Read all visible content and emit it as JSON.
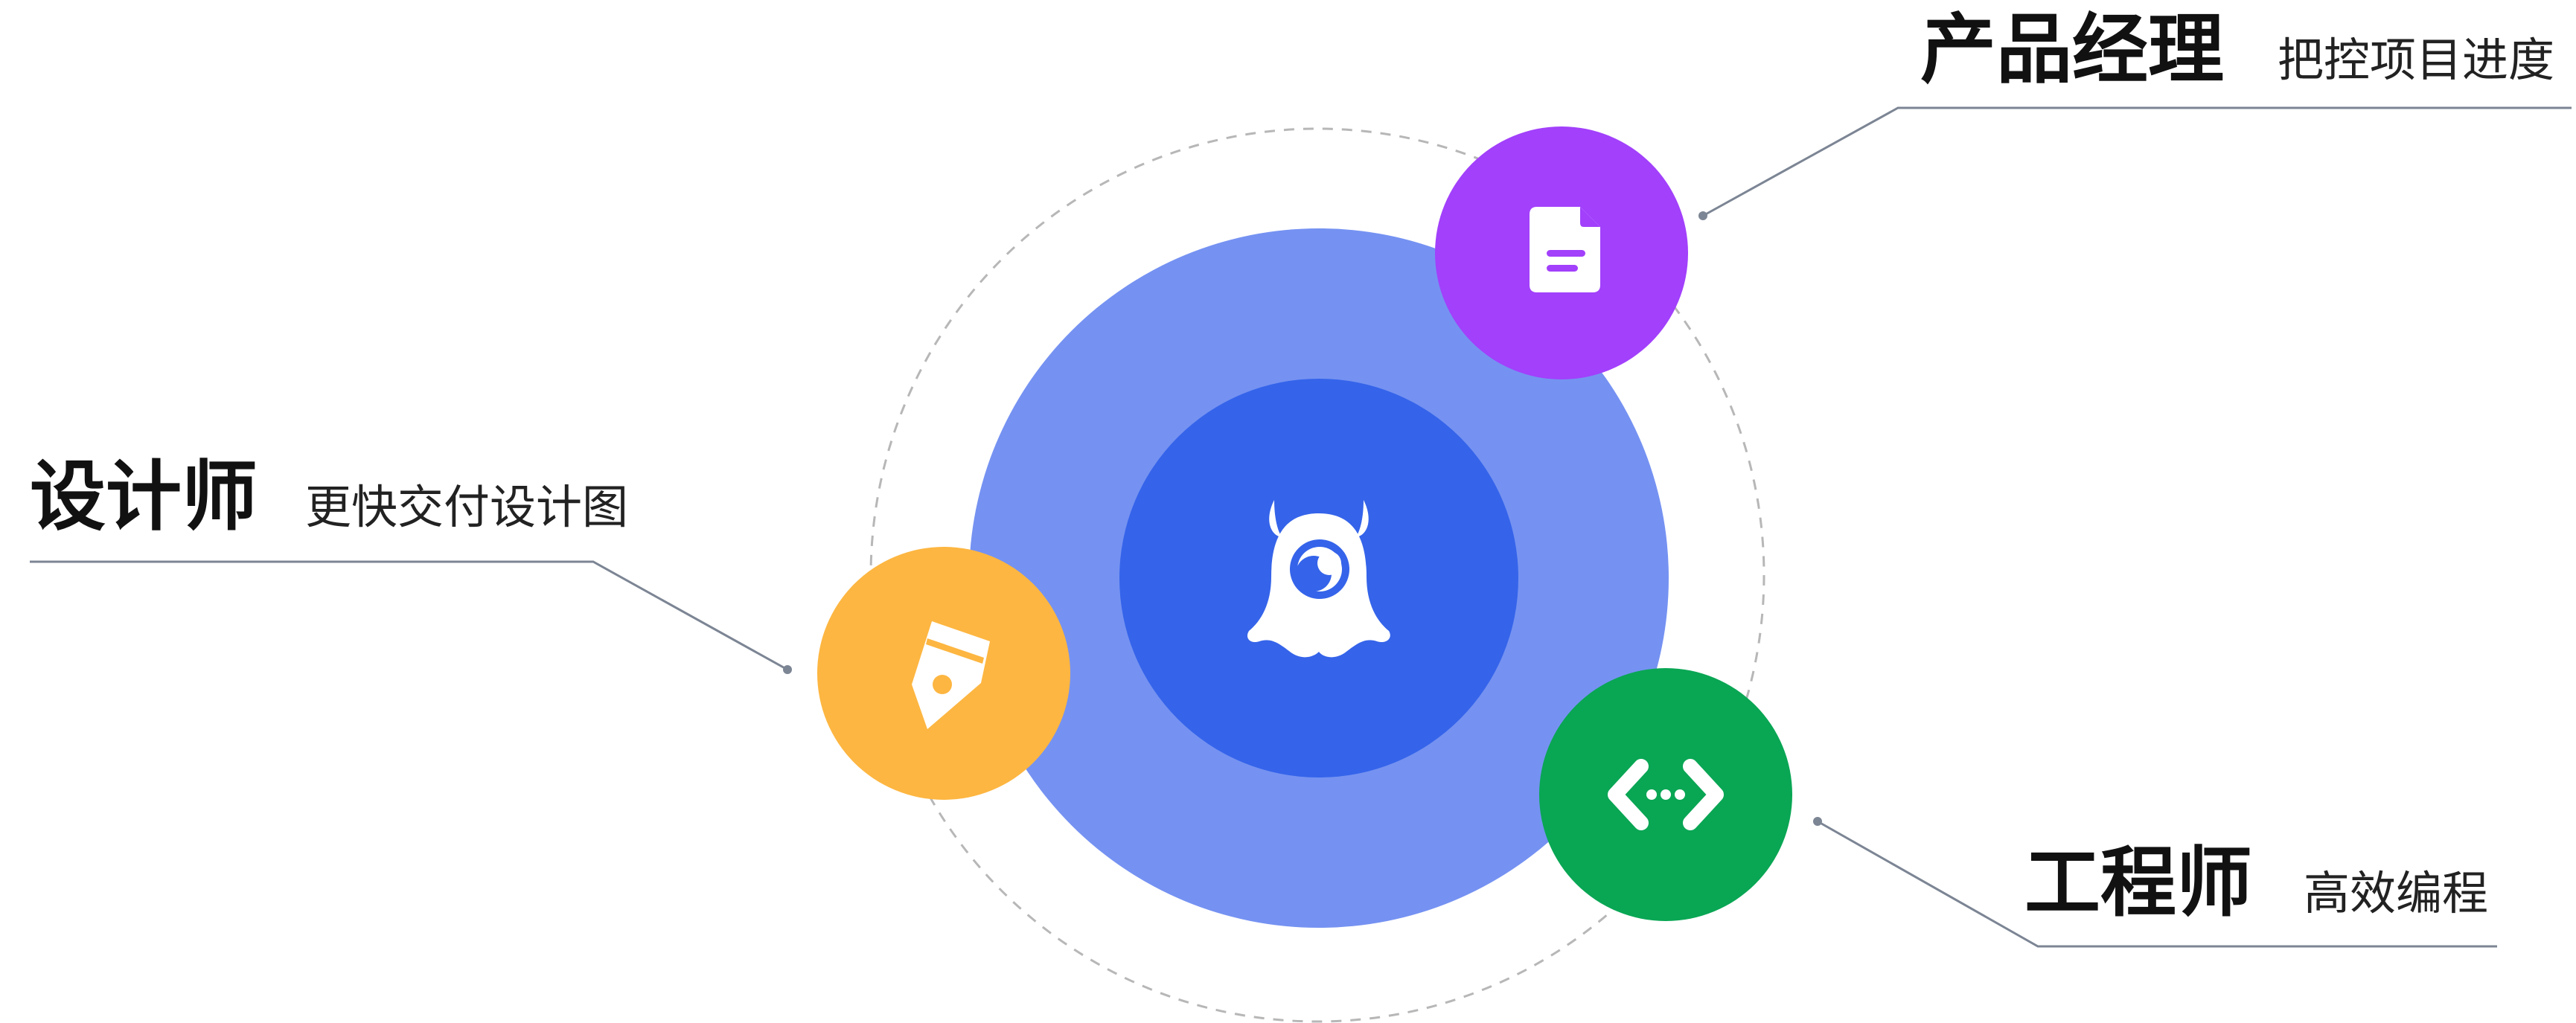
{
  "colors": {
    "outer_ring": "#7592f2",
    "core": "#3564ea",
    "product": "#a240fb",
    "designer": "#fdb641",
    "engineer": "#09a654",
    "leader_line": "#7c8594",
    "dashed_orbit": "#b7b7b7",
    "icon_fill": "#ffffff"
  },
  "center": {
    "icon": "monster-logo-icon"
  },
  "roles": {
    "product": {
      "title": "产品经理",
      "desc": "把控项目进度",
      "icon": "document-icon"
    },
    "designer": {
      "title": "设计师",
      "desc": "更快交付设计图",
      "icon": "pen-nib-icon"
    },
    "engineer": {
      "title": "工程师",
      "desc": "高效编程",
      "icon": "code-brackets-icon"
    }
  }
}
